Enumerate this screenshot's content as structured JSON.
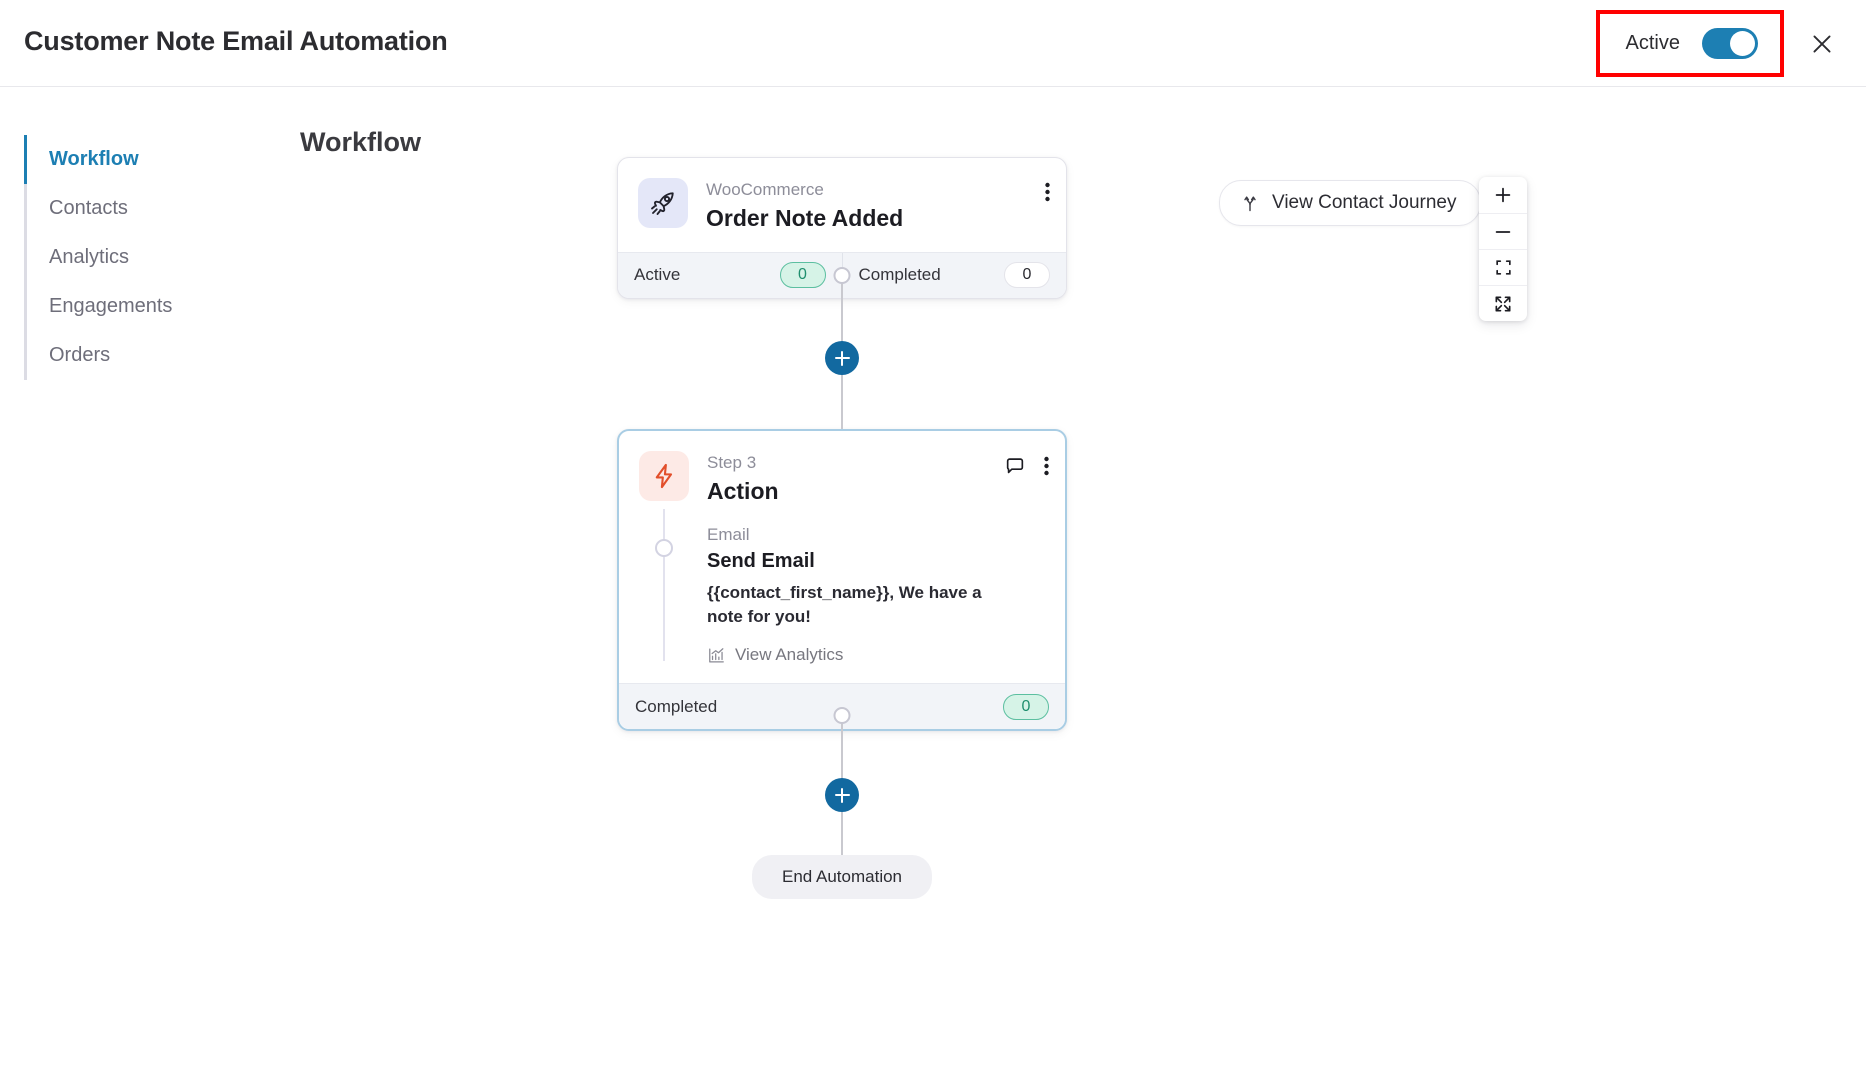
{
  "header": {
    "title": "Customer Note Email Automation",
    "status_label": "Active",
    "toggle_state": "on",
    "close_icon": "close-icon",
    "highlight_color": "#ff0000",
    "accent_color": "#1d7fb3"
  },
  "sidebar": {
    "items": [
      {
        "label": "Workflow",
        "active": true
      },
      {
        "label": "Contacts",
        "active": false
      },
      {
        "label": "Analytics",
        "active": false
      },
      {
        "label": "Engagements",
        "active": false
      },
      {
        "label": "Orders",
        "active": false
      }
    ]
  },
  "main": {
    "heading": "Workflow",
    "journey_button": {
      "label": "View Contact Journey",
      "icon": "branch-path-icon"
    },
    "zoom_controls": [
      {
        "name": "zoom-in",
        "icon": "plus-icon"
      },
      {
        "name": "zoom-out",
        "icon": "minus-icon"
      },
      {
        "name": "fit-view",
        "icon": "fit-view-icon"
      },
      {
        "name": "fullscreen",
        "icon": "fullscreen-icon"
      }
    ]
  },
  "flow": {
    "trigger_node": {
      "icon": "rocket-icon",
      "icon_bg": "#e4e7f8",
      "subtitle": "WooCommerce",
      "title": "Order Note Added",
      "menu_icon": "kebab-menu-icon",
      "footer": [
        {
          "label": "Active",
          "value": "0",
          "style": "green"
        },
        {
          "label": "Completed",
          "value": "0",
          "style": "plain"
        }
      ]
    },
    "action_node": {
      "icon": "lightning-bolt-icon",
      "icon_bg": "#fdeae6",
      "subtitle": "Step 3",
      "title": "Action",
      "comment_icon": "comment-bubble-icon",
      "menu_icon": "kebab-menu-icon",
      "body": {
        "sub": "Email",
        "title": "Send Email",
        "description": "{{contact_first_name}}, We have a note for you!",
        "analytics_link": "View Analytics",
        "analytics_icon": "bar-chart-icon"
      },
      "footer": [
        {
          "label": "Completed",
          "value": "0",
          "style": "green"
        }
      ]
    },
    "add_buttons": [
      {
        "name": "add-step-after-trigger",
        "icon": "plus-icon"
      },
      {
        "name": "add-step-after-action",
        "icon": "plus-icon"
      }
    ],
    "end_label": "End Automation"
  }
}
